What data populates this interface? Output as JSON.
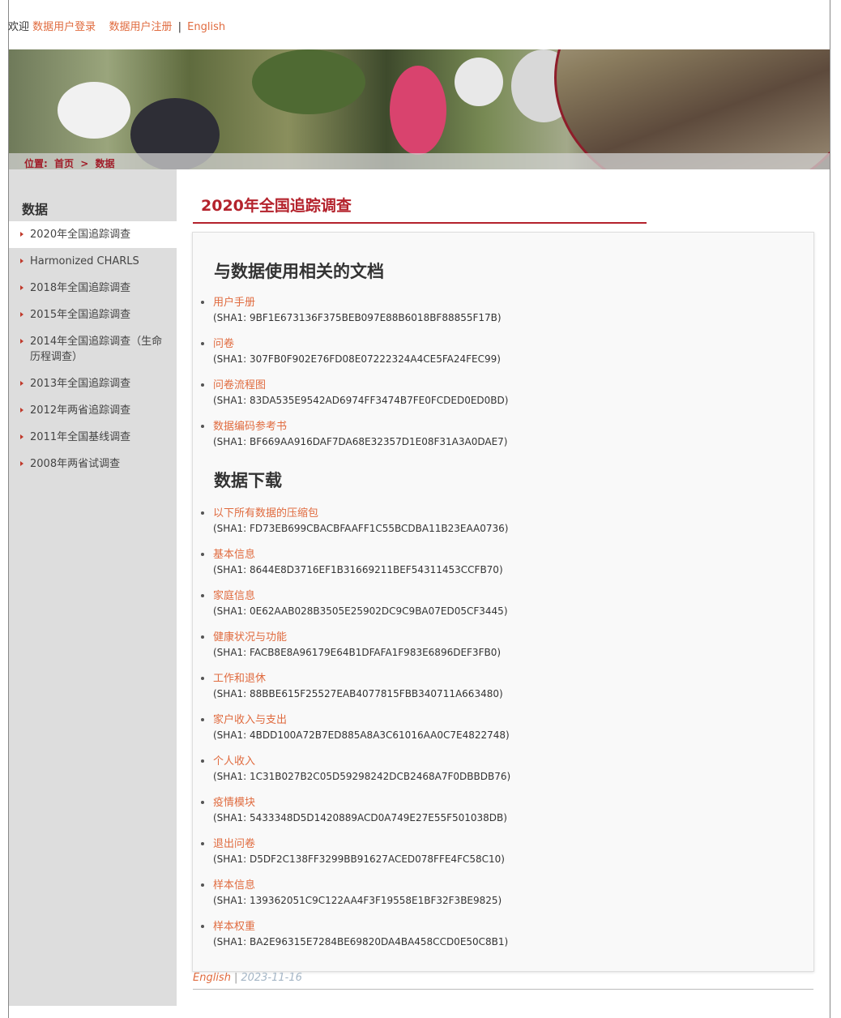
{
  "topbar": {
    "welcome": "欢迎",
    "login": "数据用户登录",
    "register": "数据用户注册",
    "separator": "|",
    "english": "English"
  },
  "breadcrumb": {
    "location": "位置:",
    "home": "首页",
    "arrow": ">",
    "current": "数据"
  },
  "sidebar": {
    "title": "数据",
    "items": [
      {
        "label": "2020年全国追踪调查"
      },
      {
        "label": "Harmonized CHARLS"
      },
      {
        "label": "2018年全国追踪调查"
      },
      {
        "label": "2015年全国追踪调查"
      },
      {
        "label": "2014年全国追踪调查（生命历程调查）"
      },
      {
        "label": "2013年全国追踪调查"
      },
      {
        "label": "2012年两省追踪调查"
      },
      {
        "label": "2011年全国基线调查"
      },
      {
        "label": "2008年两省试调查"
      }
    ]
  },
  "main": {
    "title": "2020年全国追踪调查",
    "docs_heading": "与数据使用相关的文档",
    "docs": [
      {
        "label": "用户手册",
        "hash": "(SHA1: 9BF1E673136F375BEB097E88B6018BF88855F17B)"
      },
      {
        "label": "问卷",
        "hash": "(SHA1: 307FB0F902E76FD08E07222324A4CE5FA24FEC99)"
      },
      {
        "label": "问卷流程图",
        "hash": "(SHA1: 83DA535E9542AD6974FF3474B7FE0FCDED0ED0BD)"
      },
      {
        "label": "数据编码参考书",
        "hash": "(SHA1: BF669AA916DAF7DA68E32357D1E08F31A3A0DAE7)"
      }
    ],
    "download_heading": "数据下载",
    "downloads": [
      {
        "label": "以下所有数据的压缩包",
        "hash": "(SHA1: FD73EB699CBACBFAAFF1C55BCDBA11B23EAA0736)"
      },
      {
        "label": "基本信息",
        "hash": "(SHA1: 8644E8D3716EF1B31669211BEF54311453CCFB70)"
      },
      {
        "label": "家庭信息",
        "hash": "(SHA1: 0E62AAB028B3505E25902DC9C9BA07ED05CF3445)"
      },
      {
        "label": "健康状况与功能",
        "hash": "(SHA1: FACB8E8A96179E64B1DFAFA1F983E6896DEF3FB0)"
      },
      {
        "label": "工作和退休",
        "hash": "(SHA1: 88BBE615F25527EAB4077815FBB340711A663480)"
      },
      {
        "label": "家户收入与支出",
        "hash": "(SHA1: 4BDD100A72B7ED885A8A3C61016AA0C7E4822748)"
      },
      {
        "label": "个人收入",
        "hash": "(SHA1: 1C31B027B2C05D59298242DCB2468A7F0DBBDB76)"
      },
      {
        "label": "疫情模块",
        "hash": "(SHA1: 5433348D5D1420889ACD0A749E27E55F501038DB)"
      },
      {
        "label": "退出问卷",
        "hash": "(SHA1: D5DF2C138FF3299BB91627ACED078FFE4FC58C10)"
      },
      {
        "label": "样本信息",
        "hash": "(SHA1: 139362051C9C122AA4F3F19558E1BF32F3BE9825)"
      },
      {
        "label": "样本权重",
        "hash": "(SHA1: BA2E96315E7284BE69820DA4BA458CCD0E50C8B1)"
      }
    ]
  },
  "footer": {
    "language": "English",
    "separator": "|",
    "date": "2023-11-16"
  },
  "colors": {
    "accent_red": "#b4222c",
    "link_orange": "#e06b3f",
    "sidebar_bg": "#dddddd"
  }
}
